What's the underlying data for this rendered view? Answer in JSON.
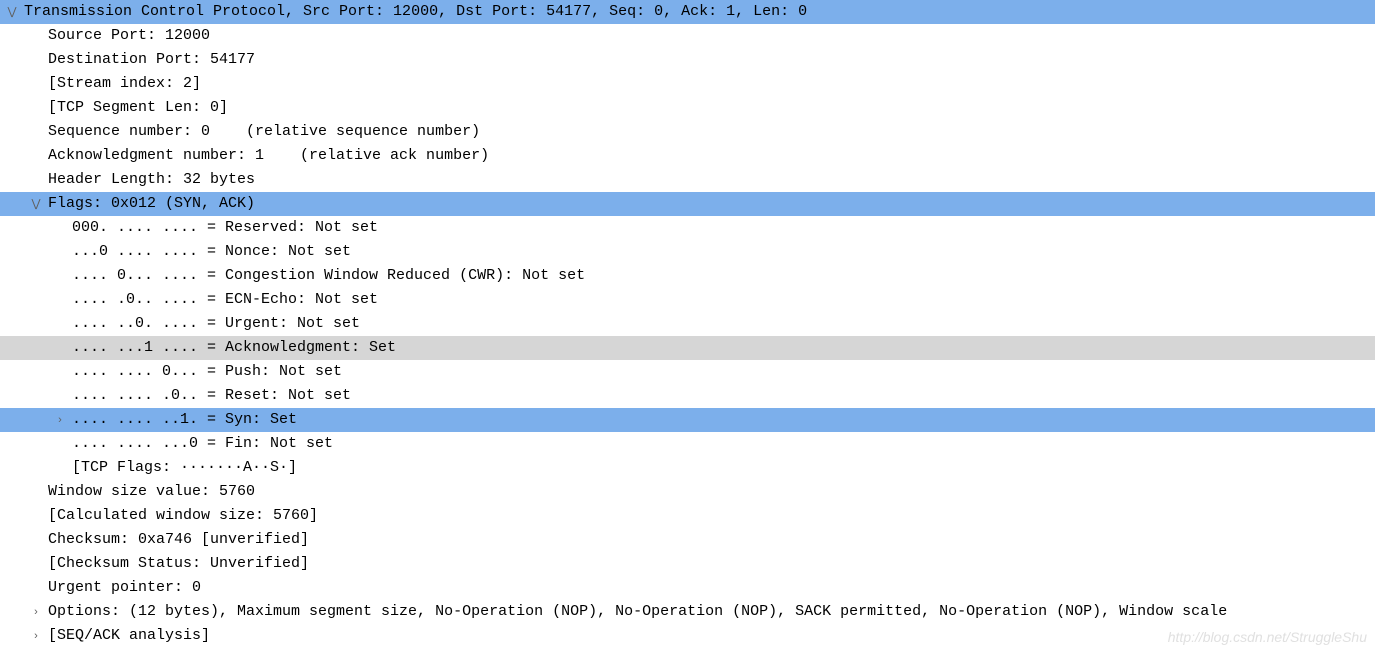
{
  "tcp": {
    "header": "Transmission Control Protocol, Src Port: 12000, Dst Port: 54177, Seq: 0, Ack: 1, Len: 0",
    "src_port": "Source Port: 12000",
    "dst_port": "Destination Port: 54177",
    "stream_index": "[Stream index: 2]",
    "seg_len": "[TCP Segment Len: 0]",
    "seq": "Sequence number: 0    (relative sequence number)",
    "ack": "Acknowledgment number: 1    (relative ack number)",
    "hdr_len": "Header Length: 32 bytes",
    "flags_summary": "Flags: 0x012 (SYN, ACK)",
    "flags": {
      "reserved": "000. .... .... = Reserved: Not set",
      "nonce": "...0 .... .... = Nonce: Not set",
      "cwr": ".... 0... .... = Congestion Window Reduced (CWR): Not set",
      "ecn": ".... .0.. .... = ECN-Echo: Not set",
      "urg": ".... ..0. .... = Urgent: Not set",
      "ackf": ".... ...1 .... = Acknowledgment: Set",
      "psh": ".... .... 0... = Push: Not set",
      "rst": ".... .... .0.. = Reset: Not set",
      "syn": ".... .... ..1. = Syn: Set",
      "fin": ".... .... ...0 = Fin: Not set",
      "str": "[TCP Flags: ·······A··S·]"
    },
    "win_size": "Window size value: 5760",
    "calc_win": "[Calculated window size: 5760]",
    "checksum": "Checksum: 0xa746 [unverified]",
    "chk_status": "[Checksum Status: Unverified]",
    "urg_ptr": "Urgent pointer: 0",
    "options": "Options: (12 bytes), Maximum segment size, No-Operation (NOP), No-Operation (NOP), SACK permitted, No-Operation (NOP), Window scale",
    "seqack": "[SEQ/ACK analysis]"
  },
  "watermark": "http://blog.csdn.net/StruggleShu"
}
